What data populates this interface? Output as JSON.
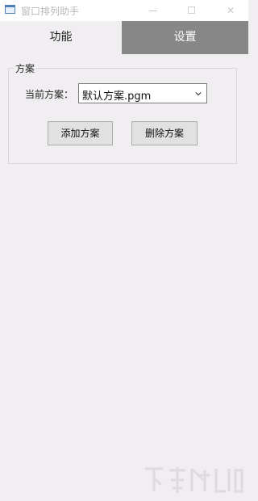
{
  "window": {
    "title": "窗口排列助手"
  },
  "tabs": [
    {
      "label": "功能",
      "active": false
    },
    {
      "label": "设置",
      "active": true
    }
  ],
  "settings": {
    "group_title": "方案",
    "current_plan_label": "当前方案：",
    "current_plan_value": "默认方案.pgm",
    "add_button": "添加方案",
    "delete_button": "删除方案"
  },
  "colors": {
    "active_tab_bg": "#878787",
    "background": "#f0eef1",
    "button_bg": "#e1e1e1"
  },
  "icons": [
    "window-app-icon",
    "minimize-icon",
    "maximize-icon",
    "close-icon",
    "chevron-down-icon"
  ]
}
